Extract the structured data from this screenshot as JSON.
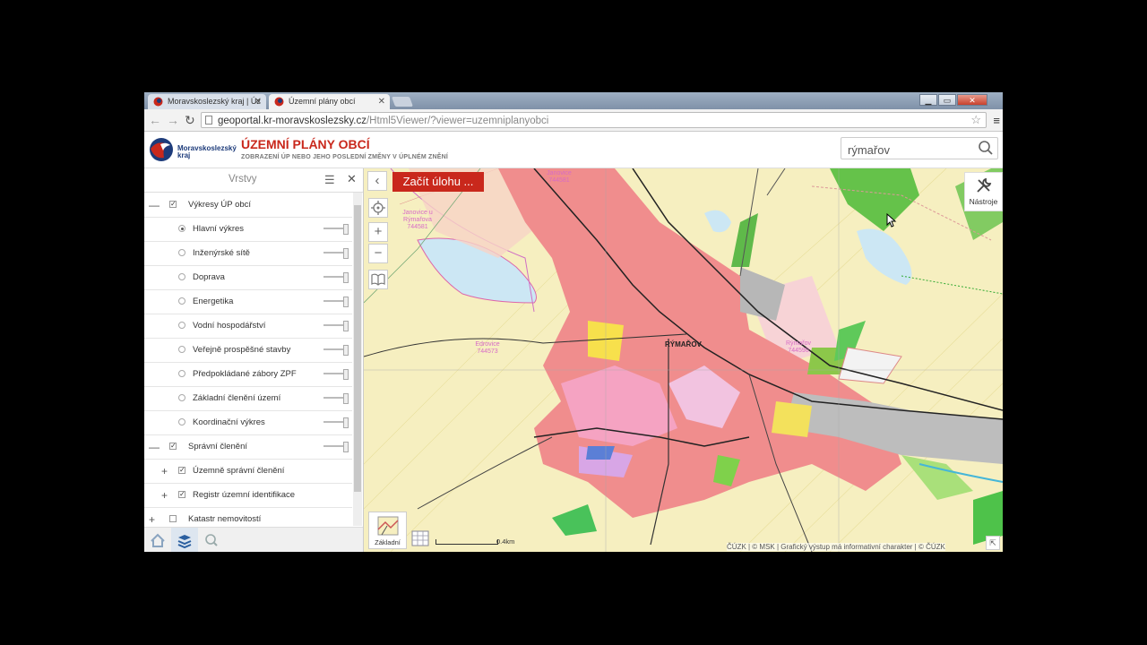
{
  "browser": {
    "tabs": [
      {
        "title": "Moravskoslezský kraj | Úz"
      },
      {
        "title": "Územní plány obcí"
      }
    ],
    "url_main": "geoportal.kr-moravskoslezsky.cz",
    "url_path": "/Html5Viewer/?viewer=uzemniplanyobci"
  },
  "header": {
    "logo_text": "Moravskoslezský kraj",
    "title": "ÚZEMNÍ PLÁNY OBCÍ",
    "subtitle": "ZOBRAZENÍ ÚP NEBO JEHO POSLEDNÍ ZMĚNY V ÚPLNÉM ZNĚNÍ",
    "search_value": "rýmařov"
  },
  "panel": {
    "title": "Vrstvy",
    "layers": [
      {
        "label": "Výkresy ÚP obcí",
        "type": "group",
        "checked": true
      },
      {
        "label": "Hlavní výkres",
        "type": "radio",
        "selected": true
      },
      {
        "label": "Inženýrské sítě",
        "type": "radio"
      },
      {
        "label": "Doprava",
        "type": "radio"
      },
      {
        "label": "Energetika",
        "type": "radio"
      },
      {
        "label": "Vodní hospodářství",
        "type": "radio"
      },
      {
        "label": "Veřejně prospěšné stavby",
        "type": "radio"
      },
      {
        "label": "Předpokládané zábory ZPF",
        "type": "radio"
      },
      {
        "label": "Základní členění území",
        "type": "radio"
      },
      {
        "label": "Koordinační výkres",
        "type": "radio"
      },
      {
        "label": "Správní členění",
        "type": "group",
        "checked": true
      },
      {
        "label": "Územně správní členění",
        "type": "subgroup",
        "checked": true
      },
      {
        "label": "Registr územní identifikace",
        "type": "subgroup",
        "checked": true
      },
      {
        "label": "Katastr nemovitostí",
        "type": "group",
        "checked": false
      }
    ]
  },
  "map": {
    "start_button": "Začít úlohu ...",
    "tools_label": "Nástroje",
    "basemap_label": "Základní",
    "scale_label": "0.4km",
    "town_label": "RÝMAŘOV",
    "place_labels": [
      {
        "name": "Janovice u Rýmařova",
        "code": "744581"
      },
      {
        "name": "Edrovice",
        "code": "744573"
      },
      {
        "name": "Rýmařov",
        "code": "744590"
      },
      {
        "name": "Janovice",
        "code": "744581"
      }
    ],
    "attribution": "ČÚZK | © MSK | Grafický výstup má informativní charakter | © ČÚZK"
  },
  "colors": {
    "accent": "#c9281c",
    "brand": "#1d3b7a"
  }
}
